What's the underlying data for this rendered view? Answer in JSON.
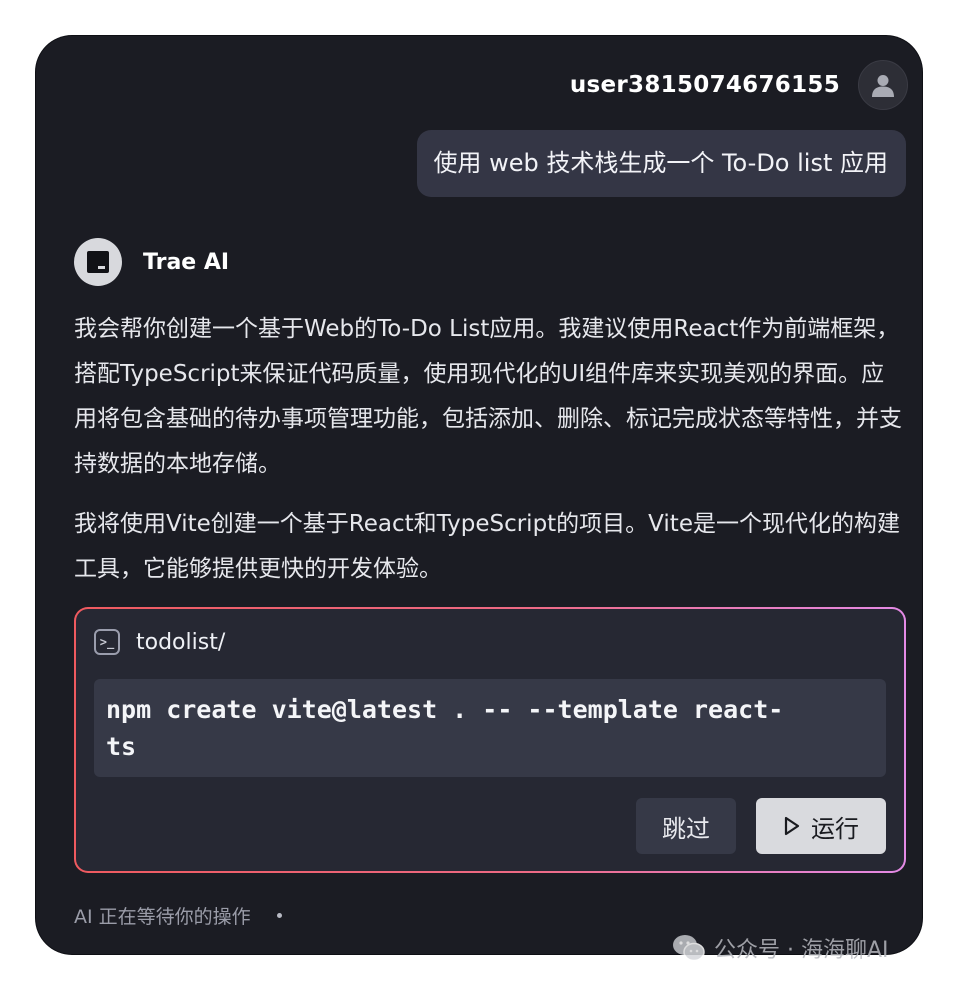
{
  "user": {
    "name": "user3815074676155",
    "message": "使用 web 技术栈生成一个 To-Do list 应用"
  },
  "assistant": {
    "name": "Trae AI",
    "paragraph1": "我会帮你创建一个基于Web的To-Do List应用。我建议使用React作为前端框架，搭配TypeScript来保证代码质量，使用现代化的UI组件库来实现美观的界面。应用将包含基础的待办事项管理功能，包括添加、删除、标记完成状态等特性，并支持数据的本地存储。",
    "paragraph2": "我将使用Vite创建一个基于React和TypeScript的项目。Vite是一个现代化的构建工具，它能够提供更快的开发体验。"
  },
  "terminal": {
    "icon": "terminal-icon",
    "path": "todolist/",
    "command": "npm create vite@latest . -- --template react-\nts",
    "skip_label": "跳过",
    "run_label": "运行"
  },
  "status": {
    "text": "AI 正在等待你的操作"
  },
  "watermark": {
    "text": "公众号 · 海海聊AI"
  },
  "colors": {
    "background": "#1b1c23",
    "bubble": "#343645",
    "card_border_start": "#ef5a5f",
    "card_border_end": "#e48ae6"
  }
}
